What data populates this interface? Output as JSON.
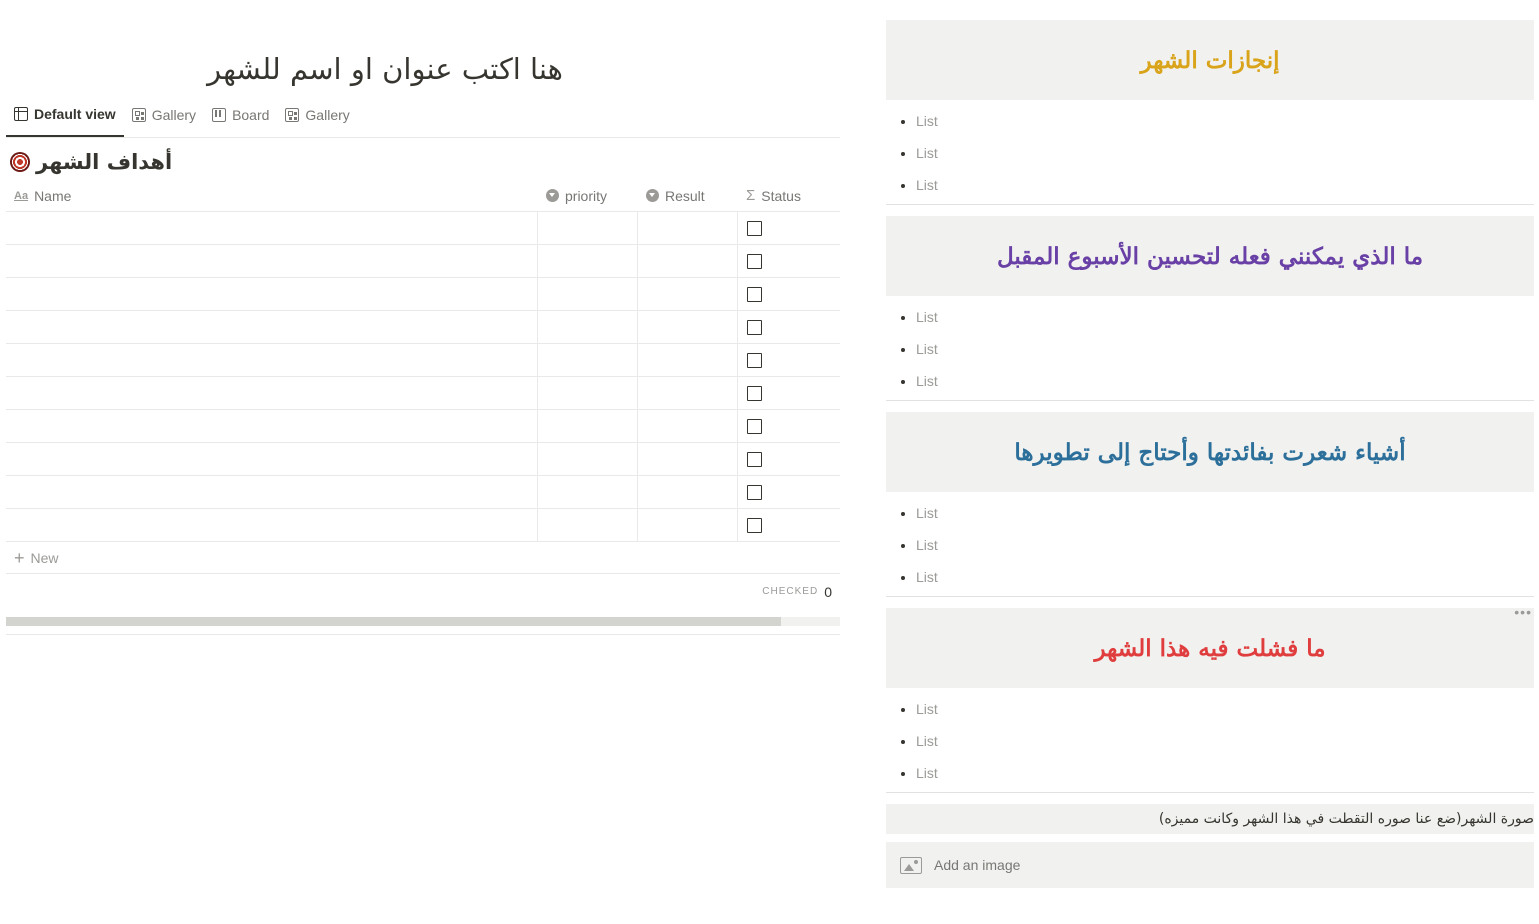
{
  "page": {
    "title": "هنا اكتب عنوان او اسم للشهر"
  },
  "tabs": [
    {
      "label": "Default view",
      "icon": "table-icon",
      "active": true
    },
    {
      "label": "Gallery",
      "icon": "gallery-icon",
      "active": false
    },
    {
      "label": "Board",
      "icon": "board-icon",
      "active": false
    },
    {
      "label": "Gallery",
      "icon": "gallery-icon",
      "active": false
    }
  ],
  "database": {
    "title": "أهداف الشهر",
    "icon": "target-icon",
    "columns": [
      {
        "label": "Name",
        "icon": "text-property-icon"
      },
      {
        "label": "priority",
        "icon": "select-property-icon"
      },
      {
        "label": "Result",
        "icon": "select-property-icon"
      },
      {
        "label": "Status",
        "icon": "sigma-icon"
      }
    ],
    "row_count": 10,
    "rows_checked": [
      false,
      false,
      false,
      false,
      false,
      false,
      false,
      false,
      false,
      false
    ],
    "new_label": "New",
    "calc_label": "CHECKED",
    "calc_value": "0"
  },
  "cards": [
    {
      "title": "إنجازات الشهر",
      "color": "#d9a31a",
      "items": [
        "List",
        "List",
        "List"
      ]
    },
    {
      "title": "ما الذي يمكنني فعله لتحسين الأسبوع المقبل",
      "color": "#6940a5",
      "items": [
        "List",
        "List",
        "List"
      ]
    },
    {
      "title": "أشياء شعرت بفائدتها وأحتاج إلى تطويرها",
      "color": "#2b6f9a",
      "items": [
        "List",
        "List",
        "List"
      ]
    },
    {
      "title": "ما فشلت فيه هذا الشهر",
      "color": "#e03e3e",
      "items": [
        "List",
        "List",
        "List"
      ]
    }
  ],
  "photo": {
    "caption": "صورة الشهر(ضع عنا صوره التقطت في هذا الشهر وكانت مميزه)",
    "add_image_label": "Add an image"
  }
}
